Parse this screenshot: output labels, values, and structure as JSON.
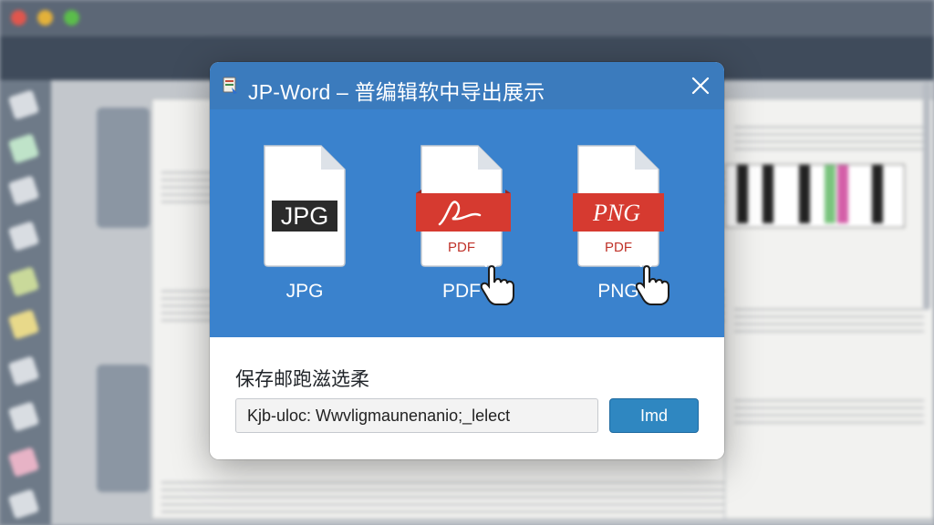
{
  "dialog": {
    "title": "JP-Word – 普编辑软中导出展示",
    "formats": [
      {
        "label": "JPG",
        "badge": "JPG"
      },
      {
        "label": "PDF",
        "badge": "PDF"
      },
      {
        "label": "PNG",
        "badge": "PNG",
        "sub": "PDF"
      }
    ],
    "save_label": "保存邮跑滋选柔",
    "path_value": "Kjb-uloc: Wwvligmaunenanio;_lelect",
    "export_button": "Imd"
  },
  "colors": {
    "header": "#3b7bbd",
    "body": "#3a82cd",
    "pdf_red": "#d63a30",
    "button": "#2f87c1"
  },
  "icons": {
    "close": "close-icon",
    "cursor": "hand-pointer-icon",
    "app": "app-icon"
  }
}
